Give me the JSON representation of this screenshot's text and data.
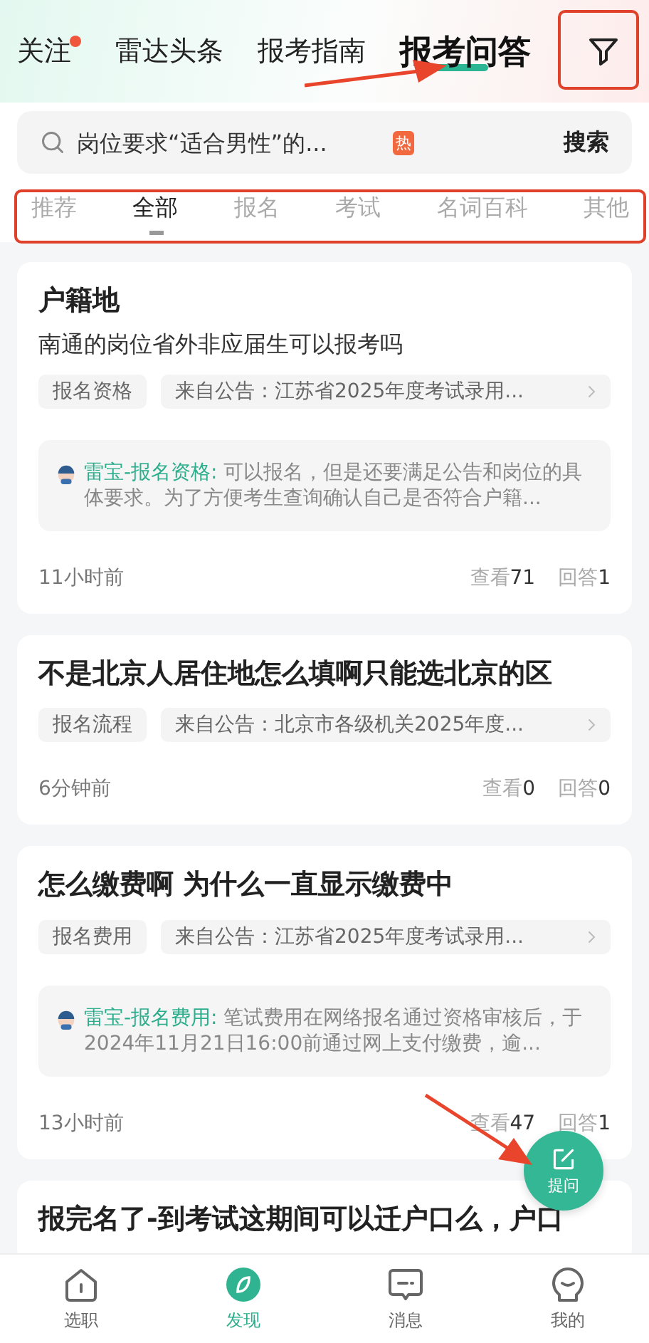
{
  "top_tabs": [
    {
      "label": "关注",
      "selected": false,
      "dot": true
    },
    {
      "label": "雷达头条",
      "selected": false,
      "dot": false
    },
    {
      "label": "报考指南",
      "selected": false,
      "dot": false
    },
    {
      "label": "报考问答",
      "selected": true,
      "dot": false
    }
  ],
  "search": {
    "placeholder": "岗位要求“适合男性”的...",
    "hot": "热",
    "button": "搜索"
  },
  "categories": [
    {
      "label": "推荐",
      "selected": false
    },
    {
      "label": "全部",
      "selected": true
    },
    {
      "label": "报名",
      "selected": false
    },
    {
      "label": "考试",
      "selected": false
    },
    {
      "label": "名词百科",
      "selected": false
    },
    {
      "label": "其他",
      "selected": false
    }
  ],
  "questions": [
    {
      "title": "户籍地",
      "body": "南通的岗位省外非应届生可以报考吗",
      "tag": "报名资格",
      "source": "来自公告：江苏省2025年度考试录用...",
      "answer": {
        "author": "雷宝-报名资格:",
        "text": " 可以报名，但是还要满足公告和岗位的具体要求。为了方便考生查询确认自己是否符合户籍..."
      },
      "time": "11小时前",
      "views_label": "查看",
      "views": "71",
      "answers_label": "回答",
      "answers": "1"
    },
    {
      "title": "不是北京人居住地怎么填啊只能选北京的区",
      "tag": "报名流程",
      "source": "来自公告：北京市各级机关2025年度...",
      "time": "6分钟前",
      "views_label": "查看",
      "views": "0",
      "answers_label": "回答",
      "answers": "0"
    },
    {
      "title": "怎么缴费啊  为什么一直显示缴费中",
      "tag": "报名费用",
      "source": "来自公告：江苏省2025年度考试录用...",
      "answer": {
        "author": "雷宝-报名费用:",
        "text": " 笔试费用在网络报名通过资格审核后，于2024年11月21日16:00前通过网上支付缴费，逾..."
      },
      "time": "13小时前",
      "views_label": "查看",
      "views": "47",
      "answers_label": "回答",
      "answers": "1"
    },
    {
      "title": "报完名了-到考试这期间可以迁户口么，户口"
    }
  ],
  "fab": {
    "label": "提问"
  },
  "nav": [
    {
      "label": "选职",
      "selected": false
    },
    {
      "label": "发现",
      "selected": true
    },
    {
      "label": "消息",
      "selected": false
    },
    {
      "label": "我的",
      "selected": false
    }
  ]
}
